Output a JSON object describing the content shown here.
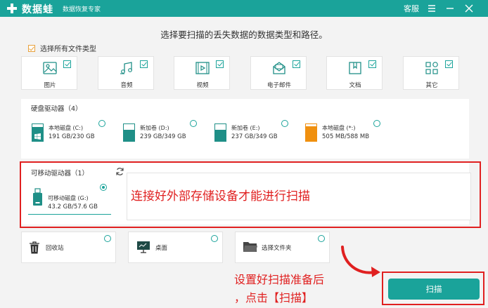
{
  "titlebar": {
    "app_name": "数据蛙",
    "app_subtitle": "数据恢复专家",
    "support_label": "客服",
    "bg_color": "#1aa39a"
  },
  "heading": "选择要扫描的丢失数据的数据类型和路径。",
  "select_all": {
    "label": "选择所有文件类型",
    "checked": true
  },
  "file_types": [
    {
      "label": "图片",
      "icon": "image-icon",
      "checked": true
    },
    {
      "label": "音频",
      "icon": "music-icon",
      "checked": true
    },
    {
      "label": "视频",
      "icon": "video-icon",
      "checked": true
    },
    {
      "label": "电子邮件",
      "icon": "email-icon",
      "checked": true
    },
    {
      "label": "文档",
      "icon": "document-icon",
      "checked": true
    },
    {
      "label": "其它",
      "icon": "other-icon",
      "checked": true
    }
  ],
  "hard_drives": {
    "title": "硬盘驱动器（4）",
    "items": [
      {
        "name": "本地磁盘 (C:)",
        "size": "191 GB/230 GB",
        "used_fraction": 0.83,
        "color": "#1f8f87"
      },
      {
        "name": "新加卷 (D:)",
        "size": "239 GB/349 GB",
        "used_fraction": 0.68,
        "color": "#1f8f87"
      },
      {
        "name": "新加卷 (E:)",
        "size": "237 GB/349 GB",
        "used_fraction": 0.68,
        "color": "#1f8f87"
      },
      {
        "name": "本地磁盘 (*:)",
        "size": "505 MB/588 MB",
        "used_fraction": 0.86,
        "color": "#f0900f"
      }
    ]
  },
  "removable_drives": {
    "title": "可移动驱动器（1）",
    "items": [
      {
        "name": "可移动磁盘 (G:)",
        "size": "43.2 GB/57.6 GB",
        "selected": true
      }
    ]
  },
  "notice_text": "连接好外部存储设备才能进行扫描",
  "locations": [
    {
      "label": "回收站",
      "icon": "recycle-bin-icon"
    },
    {
      "label": "桌面",
      "icon": "desktop-icon"
    },
    {
      "label": "选择文件夹",
      "icon": "folder-icon"
    }
  ],
  "hint_lines": [
    "设置好扫描准备后",
    "，点击【扫描】"
  ],
  "scan_button": "扫描",
  "annotation_color": "#e02020"
}
